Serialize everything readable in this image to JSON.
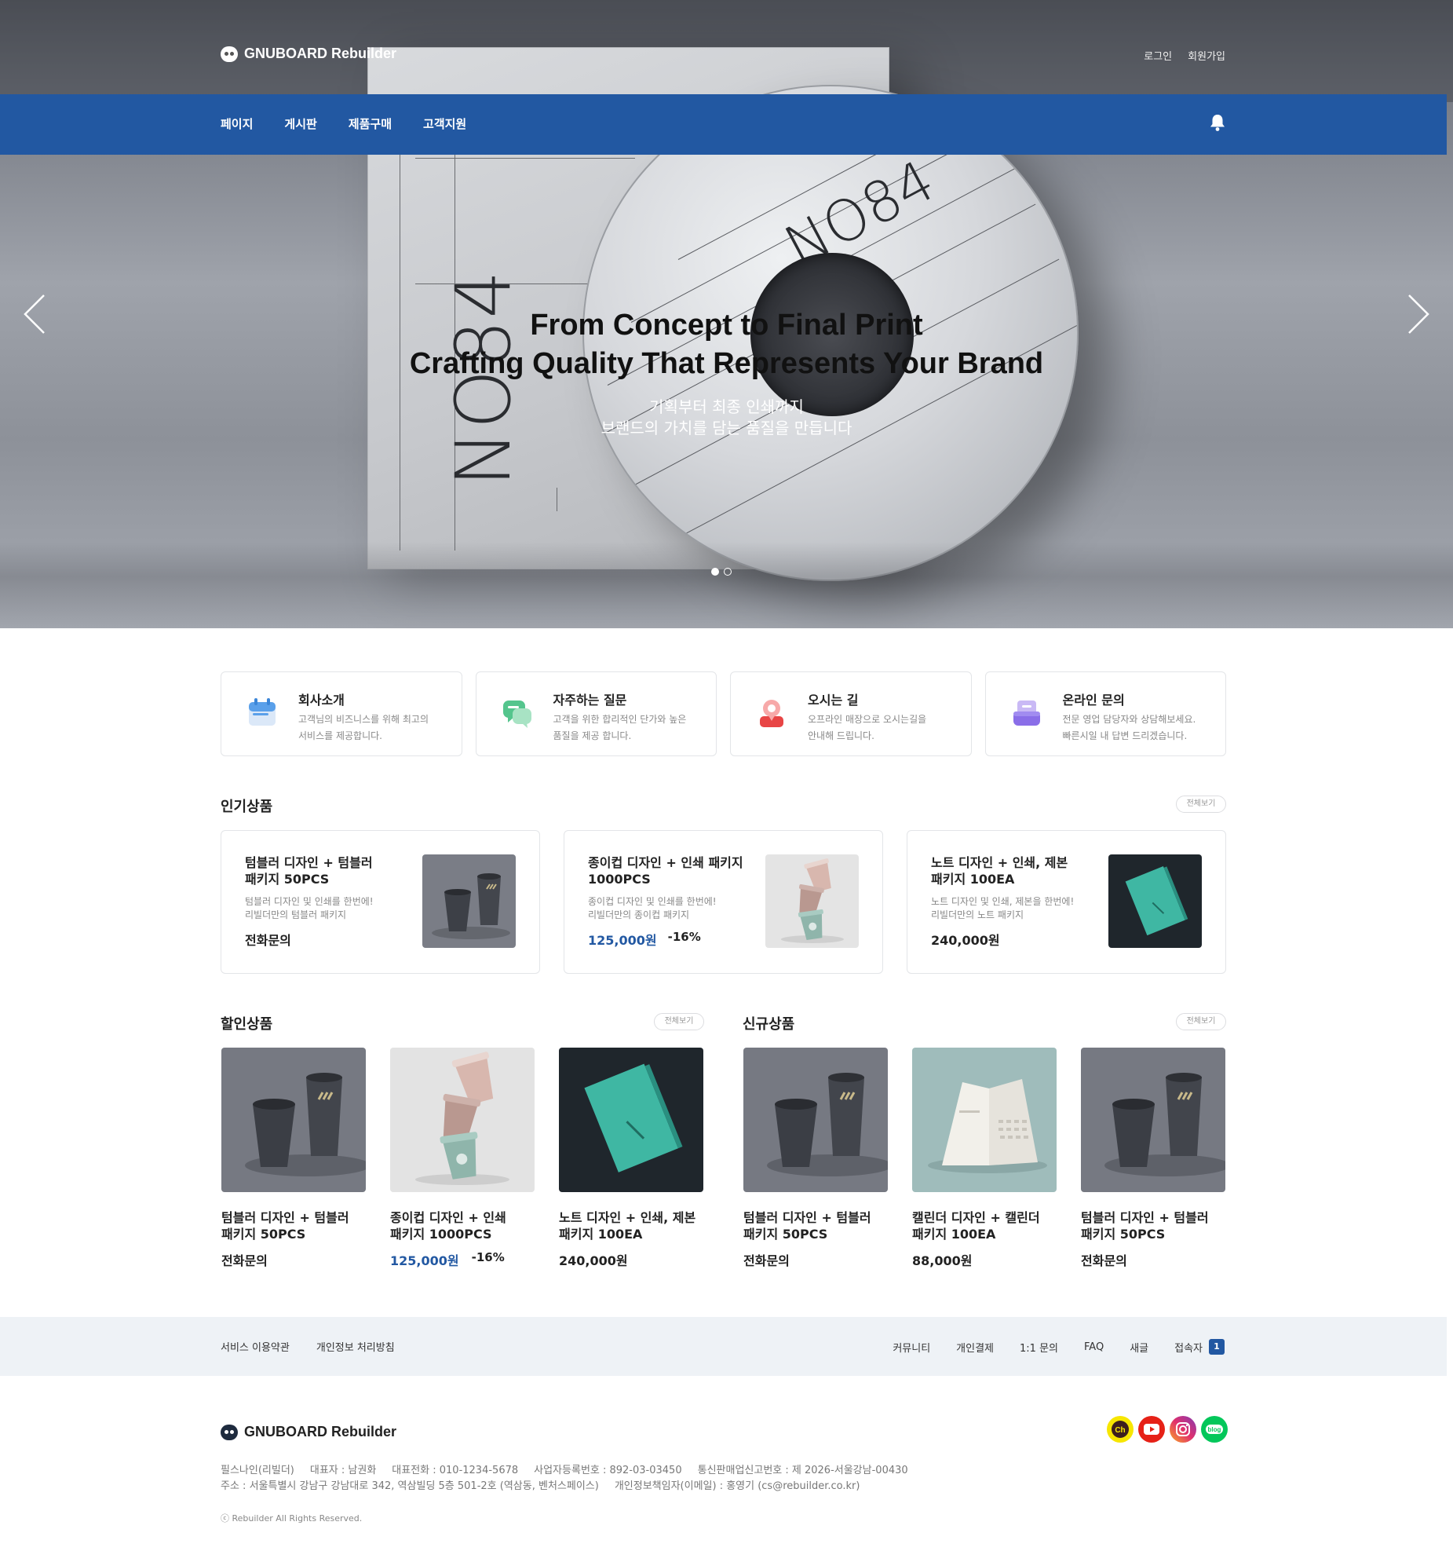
{
  "header": {
    "logo_text": "GNUBOARD Rebuilder",
    "login_label": "로그인",
    "signup_label": "회원가입"
  },
  "nav": {
    "items": [
      "페이지",
      "게시판",
      "제품구매",
      "고객지원"
    ],
    "accent_color": "#2258a2"
  },
  "hero": {
    "title_line1": "From Concept to Final Print",
    "title_line2": "Crafting Quality That Represents Your Brand",
    "sub_line1": "기획부터 최종 인쇄까지",
    "sub_line2": "브랜드의 가치를 담는 품질을 만듭니다",
    "art_text_box": "NO84",
    "art_text_disc": "NO84",
    "slide_count": 2,
    "active_slide": 1
  },
  "quick_links": [
    {
      "title": "회사소개",
      "desc_line1": "고객님의 비즈니스를 위해 최고의",
      "desc_line2": "서비스를 제공합니다.",
      "icon": "calendar-icon"
    },
    {
      "title": "자주하는 질문",
      "desc_line1": "고객을 위한 합리적인 단가와 높은",
      "desc_line2": "품질을 제공 합니다.",
      "icon": "chat-bubbles-icon"
    },
    {
      "title": "오시는 길",
      "desc_line1": "오프라인 매장으로 오시는길을",
      "desc_line2": "안내해 드립니다.",
      "icon": "location-pin-icon"
    },
    {
      "title": "온라인 문의",
      "desc_line1": "전문 영업 담당자와 상담해보세요.",
      "desc_line2": "빠른시일 내 답변 드리겠습니다.",
      "icon": "inbox-icon"
    }
  ],
  "popular": {
    "title": "인기상품",
    "more_label": "전체보기",
    "items": [
      {
        "name_line1": "텀블러 디자인 + 텀블러",
        "name_line2": "패키지 50PCS",
        "desc_line1": "텀블러 디자인 및 인쇄를 한번에!",
        "desc_line2": "리빌더만의 텀블러 패키지",
        "price": "전화문의",
        "discount": ""
      },
      {
        "name_line1": "종이컵 디자인 + 인쇄 패키지",
        "name_line2": "1000PCS",
        "desc_line1": "종이컵 디자인 및 인쇄를 한번에!",
        "desc_line2": "리빌더만의 종이컵 패키지",
        "price": "125,000원",
        "discount": "-16%"
      },
      {
        "name_line1": "노트 디자인 + 인쇄, 제본",
        "name_line2": "패키지 100EA",
        "desc_line1": "노트 디자인 및 인쇄, 제본을 한번에!",
        "desc_line2": "리빌더만의 노트 패키지",
        "price": "240,000원",
        "discount": ""
      }
    ]
  },
  "sale": {
    "title": "할인상품",
    "more_label": "전체보기",
    "items": [
      {
        "name_line1": "텀블러 디자인 + 텀블러",
        "name_line2": "패키지 50PCS",
        "price": "전화문의",
        "discount": ""
      },
      {
        "name_line1": "종이컵 디자인 + 인쇄",
        "name_line2": "패키지 1000PCS",
        "price": "125,000원",
        "discount": "-16%"
      },
      {
        "name_line1": "노트 디자인 + 인쇄, 제본",
        "name_line2": "패키지 100EA",
        "price": "240,000원",
        "discount": ""
      }
    ]
  },
  "new": {
    "title": "신규상품",
    "more_label": "전체보기",
    "items": [
      {
        "name_line1": "텀블러 디자인 + 텀블러",
        "name_line2": "패키지 50PCS",
        "price": "전화문의",
        "discount": ""
      },
      {
        "name_line1": "캘린더 디자인 + 캘린더",
        "name_line2": "패키지 100EA",
        "price": "88,000원",
        "discount": ""
      },
      {
        "name_line1": "텀블러 디자인 + 텀블러",
        "name_line2": "패키지 50PCS",
        "price": "전화문의",
        "discount": ""
      }
    ]
  },
  "footer_band": {
    "left_links": [
      "서비스 이용약관",
      "개인정보 처리방침"
    ],
    "right_links": [
      "커뮤니티",
      "개인결제",
      "1:1 문의",
      "FAQ",
      "새글"
    ],
    "visitors_label": "접속자",
    "visitors_count": "1"
  },
  "footer": {
    "logo_text": "GNUBOARD Rebuilder",
    "socials": [
      {
        "name": "kakao-channel",
        "label": "Ch",
        "color": "#f7e600"
      },
      {
        "name": "youtube",
        "label": "",
        "color": "#e62117"
      },
      {
        "name": "instagram",
        "label": "",
        "color": "#c13584"
      },
      {
        "name": "blog",
        "label": "blog",
        "color": "#03c75a"
      }
    ],
    "info_row1": [
      "필스나인(리빌더)",
      "대표자 : 남권화",
      "대표전화 : 010-1234-5678",
      "사업자등록번호 : 892-03-03450",
      "통신판매업신고번호 : 제 2026-서울강남-00430"
    ],
    "info_row2": [
      "주소 : 서울특별시 강남구 강남대로 342, 역삼빌딩 5층 501-2호 (역삼동, 벤처스페이스)",
      "개인정보책임자(이메일) : 홍영기 (cs@rebuilder.co.kr)"
    ],
    "copyright": "ⓒ Rebuilder All Rights Reserved."
  }
}
